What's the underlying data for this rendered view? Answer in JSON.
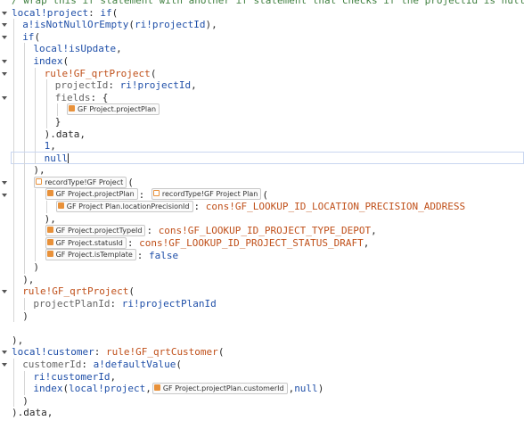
{
  "editor": {
    "lines": [
      {
        "indent": 0,
        "tokens": [
          {
            "t": "/ wrap this if statement with another if statement that checks if the projectId is null /",
            "c": "green"
          }
        ],
        "partial": true
      },
      {
        "indent": 0,
        "fold": true,
        "tokens": [
          {
            "t": "local!project",
            "c": "blue"
          },
          {
            "t": ": ",
            "c": "black"
          },
          {
            "t": "if",
            "c": "blue"
          },
          {
            "t": "(",
            "c": "black"
          }
        ]
      },
      {
        "indent": 1,
        "fold": true,
        "tokens": [
          {
            "t": "a!isNotNullOrEmpty",
            "c": "blue"
          },
          {
            "t": "(",
            "c": "black"
          },
          {
            "t": "ri!projectId",
            "c": "blue"
          },
          {
            "t": "),",
            "c": "black"
          }
        ]
      },
      {
        "indent": 1,
        "fold": true,
        "tokens": [
          {
            "t": "if",
            "c": "blue"
          },
          {
            "t": "(",
            "c": "black"
          }
        ]
      },
      {
        "indent": 2,
        "tokens": [
          {
            "t": "local!isUpdate",
            "c": "blue"
          },
          {
            "t": ",",
            "c": "black"
          }
        ]
      },
      {
        "indent": 2,
        "fold": true,
        "tokens": [
          {
            "t": "index",
            "c": "blue"
          },
          {
            "t": "(",
            "c": "black"
          }
        ]
      },
      {
        "indent": 3,
        "fold": true,
        "tokens": [
          {
            "t": "rule!GF_qrtProject",
            "c": "orange"
          },
          {
            "t": "(",
            "c": "black"
          }
        ]
      },
      {
        "indent": 4,
        "tokens": [
          {
            "t": "projectId",
            "c": "gray"
          },
          {
            "t": ": ",
            "c": "black"
          },
          {
            "t": "ri!projectId",
            "c": "blue"
          },
          {
            "t": ",",
            "c": "black"
          }
        ]
      },
      {
        "indent": 4,
        "fold": true,
        "tokens": [
          {
            "t": "fields",
            "c": "gray"
          },
          {
            "t": ": {",
            "c": "black"
          }
        ]
      },
      {
        "indent": 5,
        "tokens": [
          {
            "chip": "GF Project.projectPlan",
            "icon": "field"
          }
        ]
      },
      {
        "indent": 4,
        "tokens": [
          {
            "t": "}",
            "c": "black"
          }
        ]
      },
      {
        "indent": 3,
        "tokens": [
          {
            "t": ").data,",
            "c": "black"
          }
        ]
      },
      {
        "indent": 3,
        "tokens": [
          {
            "t": "1",
            "c": "blue"
          },
          {
            "t": ",",
            "c": "black"
          }
        ]
      },
      {
        "indent": 3,
        "cursor": true,
        "tokens": [
          {
            "t": "null",
            "c": "blue"
          }
        ]
      },
      {
        "indent": 2,
        "tokens": [
          {
            "t": "),",
            "c": "black"
          }
        ]
      },
      {
        "indent": 2,
        "fold": true,
        "tokens": [
          {
            "chip": "recordType!GF Project",
            "icon": "record"
          },
          {
            "t": "(",
            "c": "black"
          }
        ]
      },
      {
        "indent": 3,
        "fold": true,
        "tokens": [
          {
            "chip": "GF Project.projectPlan",
            "icon": "field"
          },
          {
            "t": ": ",
            "c": "black"
          },
          {
            "chip": "recordType!GF Project Plan",
            "icon": "record"
          },
          {
            "t": "(",
            "c": "black"
          }
        ]
      },
      {
        "indent": 4,
        "tokens": [
          {
            "chip": "GF Project Plan.locationPrecisionId",
            "icon": "field"
          },
          {
            "t": ": ",
            "c": "black"
          },
          {
            "t": "cons!GF_LOOKUP_ID_LOCATION_PRECISION_ADDRESS",
            "c": "orange"
          }
        ]
      },
      {
        "indent": 3,
        "tokens": [
          {
            "t": "),",
            "c": "black"
          }
        ]
      },
      {
        "indent": 3,
        "tokens": [
          {
            "chip": "GF Project.projectTypeId",
            "icon": "field"
          },
          {
            "t": ": ",
            "c": "black"
          },
          {
            "t": "cons!GF_LOOKUP_ID_PROJECT_TYPE_DEPOT",
            "c": "orange"
          },
          {
            "t": ",",
            "c": "black"
          }
        ]
      },
      {
        "indent": 3,
        "tokens": [
          {
            "chip": "GF Project.statusId",
            "icon": "field"
          },
          {
            "t": ": ",
            "c": "black"
          },
          {
            "t": "cons!GF_LOOKUP_ID_PROJECT_STATUS_DRAFT",
            "c": "orange"
          },
          {
            "t": ",",
            "c": "black"
          }
        ]
      },
      {
        "indent": 3,
        "tokens": [
          {
            "chip": "GF Project.isTemplate",
            "icon": "field"
          },
          {
            "t": ": ",
            "c": "black"
          },
          {
            "t": "false",
            "c": "blue"
          }
        ]
      },
      {
        "indent": 2,
        "tokens": [
          {
            "t": ")",
            "c": "black"
          }
        ]
      },
      {
        "indent": 1,
        "tokens": [
          {
            "t": "),",
            "c": "black"
          }
        ]
      },
      {
        "indent": 1,
        "fold": true,
        "tokens": [
          {
            "t": "rule!GF_qrtProject",
            "c": "orange"
          },
          {
            "t": "(",
            "c": "black"
          }
        ]
      },
      {
        "indent": 2,
        "tokens": [
          {
            "t": "projectPlanId",
            "c": "gray"
          },
          {
            "t": ": ",
            "c": "black"
          },
          {
            "t": "ri!projectPlanId",
            "c": "blue"
          }
        ]
      },
      {
        "indent": 1,
        "tokens": [
          {
            "t": ")",
            "c": "black"
          }
        ]
      },
      {
        "indent": 0,
        "tokens": []
      },
      {
        "indent": 0,
        "tokens": [
          {
            "t": "),",
            "c": "black"
          }
        ]
      },
      {
        "indent": 0,
        "fold": true,
        "tokens": [
          {
            "t": "local!customer",
            "c": "blue"
          },
          {
            "t": ": ",
            "c": "black"
          },
          {
            "t": "rule!GF_qrtCustomer",
            "c": "orange"
          },
          {
            "t": "(",
            "c": "black"
          }
        ]
      },
      {
        "indent": 1,
        "fold": true,
        "tokens": [
          {
            "t": "customerId",
            "c": "gray"
          },
          {
            "t": ": ",
            "c": "black"
          },
          {
            "t": "a!defaultValue",
            "c": "blue"
          },
          {
            "t": "(",
            "c": "black"
          }
        ]
      },
      {
        "indent": 2,
        "tokens": [
          {
            "t": "ri!customerId",
            "c": "blue"
          },
          {
            "t": ",",
            "c": "black"
          }
        ]
      },
      {
        "indent": 2,
        "tokens": [
          {
            "t": "index",
            "c": "blue"
          },
          {
            "t": "(",
            "c": "black"
          },
          {
            "t": "local!project",
            "c": "blue"
          },
          {
            "t": ",",
            "c": "black"
          },
          {
            "chip": "GF Project.projectPlan.customerId",
            "icon": "field"
          },
          {
            "t": ",",
            "c": "black"
          },
          {
            "t": "null",
            "c": "blue"
          },
          {
            "t": ")",
            "c": "black"
          }
        ]
      },
      {
        "indent": 1,
        "tokens": [
          {
            "t": ")",
            "c": "black"
          }
        ]
      },
      {
        "indent": 0,
        "tokens": [
          {
            "t": ").data,",
            "c": "black"
          }
        ]
      }
    ]
  },
  "colors": {
    "blue": "#1f4fa8",
    "orange": "#c0501a",
    "gray": "#666666",
    "black": "#2b2b2b",
    "green": "#3f7f3f"
  }
}
